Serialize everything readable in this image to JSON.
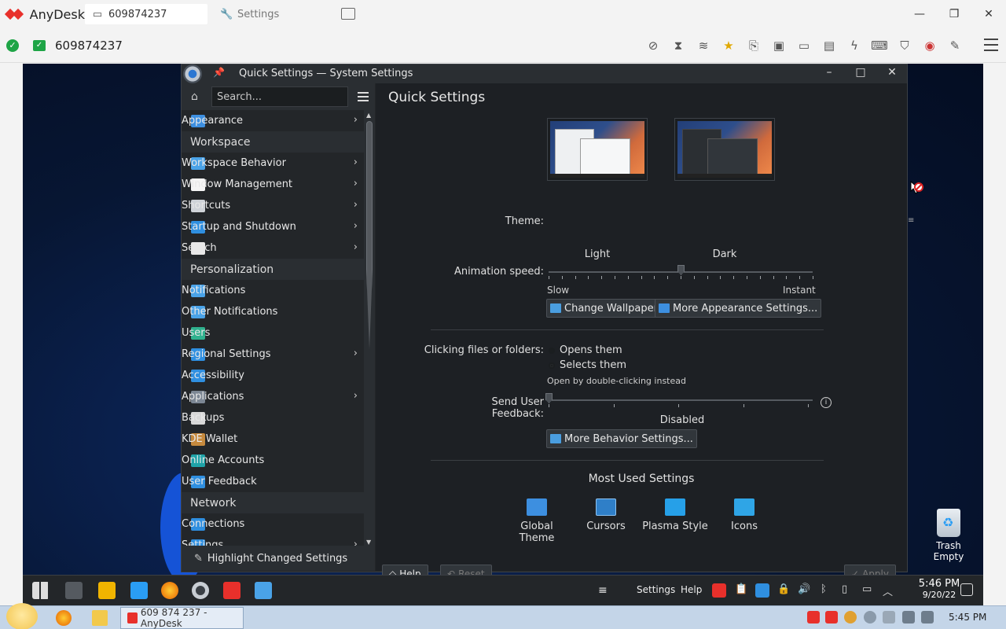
{
  "anydesk": {
    "app_name": "AnyDesk",
    "tabs": [
      {
        "label": "609874237",
        "icon": "monitor-icon"
      },
      {
        "label": "Settings",
        "icon": "wrench-icon"
      }
    ],
    "session_id": "609874237",
    "brand_color": "#e8302b"
  },
  "window": {
    "title": "Quick Settings — System Settings"
  },
  "sidebar": {
    "search_placeholder": "Search...",
    "items": [
      {
        "type": "item",
        "label": "Appearance",
        "arrow": true,
        "color": "#3d8fe0"
      },
      {
        "type": "category",
        "label": "Workspace"
      },
      {
        "type": "item",
        "label": "Workspace Behavior",
        "arrow": true,
        "color": "#4aa3e8"
      },
      {
        "type": "item",
        "label": "Window Management",
        "arrow": true,
        "color": "#f4f4f4"
      },
      {
        "type": "item",
        "label": "Shortcuts",
        "arrow": true,
        "color": "#cfd3d8"
      },
      {
        "type": "item",
        "label": "Startup and Shutdown",
        "arrow": true,
        "color": "#2f8fe0"
      },
      {
        "type": "item",
        "label": "Search",
        "arrow": true,
        "color": "#e8e8e8"
      },
      {
        "type": "category",
        "label": "Personalization"
      },
      {
        "type": "item",
        "label": "Notifications",
        "arrow": false,
        "color": "#4aa3e8"
      },
      {
        "type": "item",
        "label": "Other Notifications",
        "arrow": false,
        "color": "#4aa3e8"
      },
      {
        "type": "item",
        "label": "Users",
        "arrow": false,
        "color": "#2fb18e"
      },
      {
        "type": "item",
        "label": "Regional Settings",
        "arrow": true,
        "color": "#2f8fe0"
      },
      {
        "type": "item",
        "label": "Accessibility",
        "arrow": false,
        "color": "#2f8fe0"
      },
      {
        "type": "item",
        "label": "Applications",
        "arrow": true,
        "color": "#7c8794"
      },
      {
        "type": "item",
        "label": "Backups",
        "arrow": false,
        "color": "#d8d8d8"
      },
      {
        "type": "item",
        "label": "KDE Wallet",
        "arrow": false,
        "color": "#c68a3e"
      },
      {
        "type": "item",
        "label": "Online Accounts",
        "arrow": false,
        "color": "#1fa3a8"
      },
      {
        "type": "item",
        "label": "User Feedback",
        "arrow": false,
        "color": "#2f8fe0"
      },
      {
        "type": "category",
        "label": "Network"
      },
      {
        "type": "item",
        "label": "Connections",
        "arrow": false,
        "color": "#2f8fe0"
      },
      {
        "type": "item",
        "label": "Settings",
        "arrow": true,
        "color": "#2f8fe0"
      }
    ],
    "highlight_label": "Highlight Changed Settings"
  },
  "content": {
    "heading": "Quick Settings",
    "theme": {
      "label": "Theme:",
      "options": [
        "Light",
        "Dark"
      ]
    },
    "animation": {
      "label": "Animation speed:",
      "min_label": "Slow",
      "max_label": "Instant",
      "level": 0.5
    },
    "buttons": {
      "change_wallpaper": "Change Wallpaper...",
      "more_appearance": "More Appearance Settings...",
      "more_behavior": "More Behavior Settings..."
    },
    "clicking": {
      "label": "Clicking files or folders:",
      "option_open": "Opens them",
      "option_select": "Selects them",
      "hint": "Open by double-clicking instead",
      "selected": "Selects them"
    },
    "feedback": {
      "label": "Send User Feedback:",
      "value_label": "Disabled",
      "level": 0
    },
    "most_used": {
      "title": "Most Used Settings",
      "items": [
        {
          "label": "Global Theme",
          "icon": "global-theme-icon"
        },
        {
          "label": "Cursors",
          "icon": "cursors-icon"
        },
        {
          "label": "Plasma Style",
          "icon": "plasma-style-icon"
        },
        {
          "label": "Icons",
          "icon": "icons-icon"
        }
      ]
    },
    "footer": {
      "help": "Help",
      "reset": "Reset",
      "apply": "Apply"
    }
  },
  "desktop": {
    "trash_label": "Trash",
    "trash_sub": "Empty"
  },
  "remote_taskbar": {
    "menu_settings": "Settings",
    "menu_help": "Help",
    "time": "5:46 PM",
    "date": "9/20/22"
  },
  "host_taskbar": {
    "active_app": "609 874 237 - AnyDesk",
    "time": "5:45 PM"
  }
}
